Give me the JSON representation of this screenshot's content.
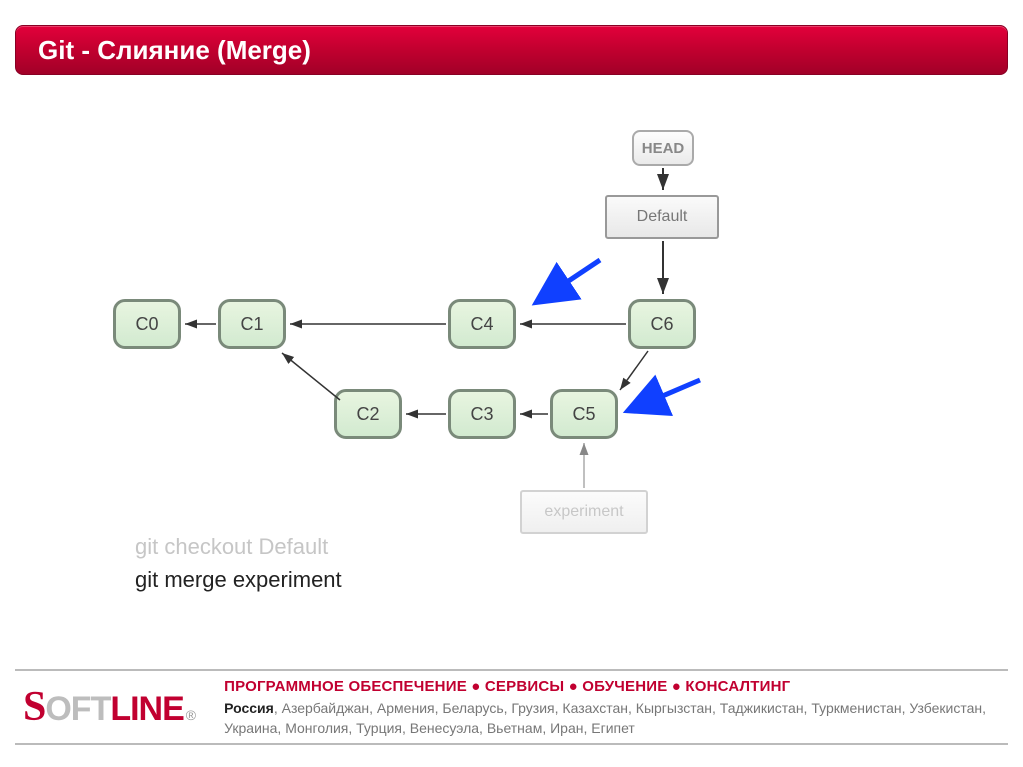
{
  "title": "Git - Слияние (Merge)",
  "refs": {
    "head": "HEAD",
    "default": "Default",
    "experiment": "experiment"
  },
  "commits": {
    "c0": "C0",
    "c1": "C1",
    "c2": "C2",
    "c3": "C3",
    "c4": "C4",
    "c5": "C5",
    "c6": "C6"
  },
  "commands": {
    "checkout": "git checkout Default",
    "merge": "git merge experiment"
  },
  "footer": {
    "logo_s": "S",
    "logo_oft": "oft",
    "logo_line": "line",
    "reg": "®",
    "services": "ПРОГРАММНОЕ ОБЕСПЕЧЕНИЕ ● СЕРВИСЫ ● ОБУЧЕНИЕ ● КОНСАЛТИНГ",
    "country_bold": "Россия",
    "countries_rest": ", Азербайджан, Армения, Беларусь, Грузия, Казахстан, Кыргызстан, Таджикистан, Туркменистан, Узбекистан, Украина, Монголия, Турция, Венесуэла, Вьетнам, Иран, Египет"
  },
  "chart_data": {
    "type": "diagram",
    "title": "Git - Слияние (Merge)",
    "nodes": [
      {
        "id": "C0",
        "kind": "commit",
        "row": 0
      },
      {
        "id": "C1",
        "kind": "commit",
        "row": 0
      },
      {
        "id": "C2",
        "kind": "commit",
        "row": 1
      },
      {
        "id": "C3",
        "kind": "commit",
        "row": 1
      },
      {
        "id": "C4",
        "kind": "commit",
        "row": 0
      },
      {
        "id": "C5",
        "kind": "commit",
        "row": 1
      },
      {
        "id": "C6",
        "kind": "commit",
        "row": 0,
        "merge": true
      },
      {
        "id": "HEAD",
        "kind": "ref"
      },
      {
        "id": "Default",
        "kind": "ref"
      },
      {
        "id": "experiment",
        "kind": "ref",
        "faded": true
      }
    ],
    "edges": [
      {
        "from": "C1",
        "to": "C0"
      },
      {
        "from": "C2",
        "to": "C1"
      },
      {
        "from": "C3",
        "to": "C2"
      },
      {
        "from": "C4",
        "to": "C1"
      },
      {
        "from": "C5",
        "to": "C3"
      },
      {
        "from": "C6",
        "to": "C4"
      },
      {
        "from": "C6",
        "to": "C5"
      },
      {
        "from": "HEAD",
        "to": "Default"
      },
      {
        "from": "Default",
        "to": "C6"
      },
      {
        "from": "experiment",
        "to": "C5"
      }
    ],
    "highlight_arrows": [
      "→C4 (merge parent)",
      "→C5 (merge parent)"
    ],
    "commands": [
      "git checkout Default",
      "git merge experiment"
    ]
  }
}
